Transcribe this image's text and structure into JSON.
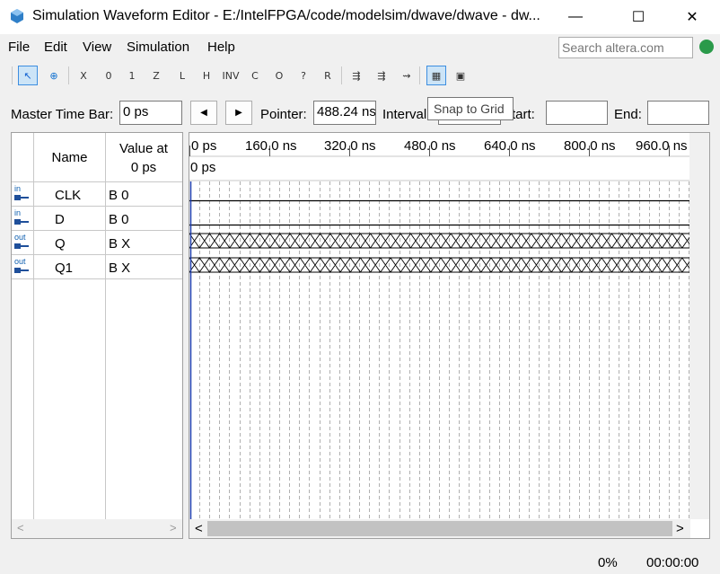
{
  "window": {
    "title": "Simulation Waveform Editor - E:/IntelFPGA/code/modelsim/dwave/dwave - dw...",
    "minimize_glyph": "—",
    "maximize_glyph": "☐",
    "close_glyph": "✕"
  },
  "menu": {
    "items": [
      {
        "label": "File"
      },
      {
        "label": "Edit"
      },
      {
        "label": "View"
      },
      {
        "label": "Simulation"
      },
      {
        "label": "Help"
      }
    ],
    "search_placeholder": "Search altera.com"
  },
  "toolbar": {
    "icons": [
      {
        "name": "selection-tool-icon",
        "glyph": "↖"
      },
      {
        "name": "zoom-tool-icon",
        "glyph": "⊕"
      },
      {
        "name": "forcing-unknown-icon",
        "glyph": "X"
      },
      {
        "name": "forcing-low-icon",
        "glyph": "0"
      },
      {
        "name": "forcing-high-icon",
        "glyph": "1"
      },
      {
        "name": "high-impedance-icon",
        "glyph": "Z"
      },
      {
        "name": "weak-low-icon",
        "glyph": "L"
      },
      {
        "name": "weak-high-icon",
        "glyph": "H"
      },
      {
        "name": "invert-icon",
        "glyph": "INV"
      },
      {
        "name": "count-value-icon",
        "glyph": "C"
      },
      {
        "name": "overwrite-clock-icon",
        "glyph": "O"
      },
      {
        "name": "arbitrary-value-icon",
        "glyph": "?"
      },
      {
        "name": "random-value-icon",
        "glyph": "R"
      },
      {
        "name": "functional-simulation-icon",
        "glyph": "⇶"
      },
      {
        "name": "timing-simulation-icon",
        "glyph": "⇶"
      },
      {
        "name": "netlist-icon",
        "glyph": "⇝"
      },
      {
        "name": "snap-to-grid-icon",
        "glyph": "▦"
      },
      {
        "name": "sort-icon",
        "glyph": "▣"
      }
    ],
    "tooltip": "Snap to Grid"
  },
  "timebar": {
    "master_label": "Master Time Bar:",
    "master_value": "0 ps",
    "prev_glyph": "◀",
    "next_glyph": "▶",
    "pointer_label": "Pointer:",
    "pointer_value": "488.24 ns",
    "interval_label": "Interval",
    "interval_value": "",
    "start_label": "tart:",
    "start_value": "",
    "end_label": "End:",
    "end_value": ""
  },
  "signals": {
    "name_header": "Name",
    "value_header_line1": "Value at",
    "value_header_line2": "0 ps",
    "rows": [
      {
        "direction": "in",
        "name": "CLK",
        "value": "B 0"
      },
      {
        "direction": "in",
        "name": "D",
        "value": "B 0"
      },
      {
        "direction": "out",
        "name": "Q",
        "value": "B X"
      },
      {
        "direction": "out",
        "name": "Q1",
        "value": "B X"
      }
    ]
  },
  "waveform": {
    "time_ticks": [
      "0 ps",
      "160.0 ns",
      "320.0 ns",
      "480.0 ns",
      "640.0 ns",
      "800.0 ns",
      "960.0 ns"
    ],
    "cursor_label": "0 ps",
    "scroll_left_glyph": "<",
    "scroll_right_glyph": ">",
    "accent_color": "#1f3fae",
    "signal_color": "#000000"
  },
  "status": {
    "progress": "0%",
    "elapsed": "00:00:00"
  }
}
